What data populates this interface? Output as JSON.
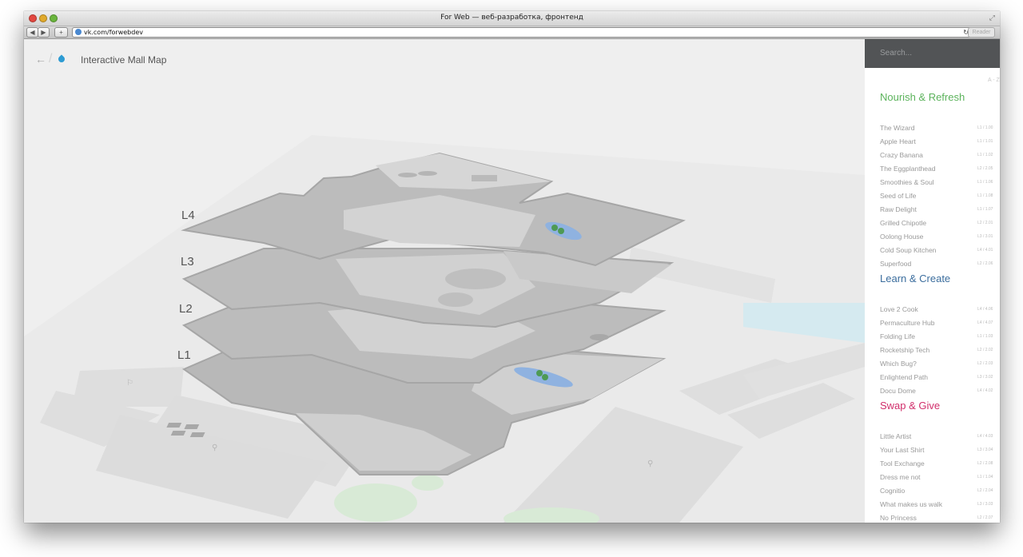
{
  "window": {
    "title": "For Web — веб-разработка, фронтенд",
    "url": "vk.com/forwebdev",
    "reader_label": "Reader"
  },
  "app": {
    "title": "Interactive Mall Map",
    "back_icon": "arrow-left-icon",
    "logo_icon": "drop-icon",
    "levels": [
      "L4",
      "L3",
      "L2",
      "L1"
    ]
  },
  "sidebar": {
    "search_placeholder": "Search...",
    "sort_icon": "A - Z",
    "sections": [
      {
        "title": "Nourish & Refresh",
        "color": "#5cb35c",
        "items": [
          {
            "name": "The Wizard",
            "code": "L1 / 1.00"
          },
          {
            "name": "Apple Heart",
            "code": "L1 / 1.01"
          },
          {
            "name": "Crazy Banana",
            "code": "L1 / 1.02"
          },
          {
            "name": "The Eggplanthead",
            "code": "L2 / 2.05"
          },
          {
            "name": "Smoothies & Soul",
            "code": "L1 / 1.06"
          },
          {
            "name": "Seed of Life",
            "code": "L1 / 1.08"
          },
          {
            "name": "Raw Delight",
            "code": "L1 / 1.07"
          },
          {
            "name": "Grilled Chipotle",
            "code": "L2 / 2.01"
          },
          {
            "name": "Oolong House",
            "code": "L3 / 3.01"
          },
          {
            "name": "Cold Soup Kitchen",
            "code": "L4 / 4.01"
          },
          {
            "name": "Superfood",
            "code": "L2 / 2.06"
          }
        ]
      },
      {
        "title": "Learn & Create",
        "color": "#3c6e9e",
        "items": [
          {
            "name": "Love 2 Cook",
            "code": "L4 / 4.06"
          },
          {
            "name": "Permaculture Hub",
            "code": "L4 / 4.07"
          },
          {
            "name": "Folding Life",
            "code": "L1 / 1.03"
          },
          {
            "name": "Rocketship Tech",
            "code": "L2 / 2.02"
          },
          {
            "name": "Which Bug?",
            "code": "L2 / 2.03"
          },
          {
            "name": "Enlightend Path",
            "code": "L3 / 3.02"
          },
          {
            "name": "Docu Dome",
            "code": "L4 / 4.02"
          }
        ]
      },
      {
        "title": "Swap & Give",
        "color": "#d12e6b",
        "items": [
          {
            "name": "Little Artist",
            "code": "L4 / 4.03"
          },
          {
            "name": "Your Last Shirt",
            "code": "L3 / 3.04"
          },
          {
            "name": "Tool Exchange",
            "code": "L2 / 2.08"
          },
          {
            "name": "Dress me not",
            "code": "L1 / 1.04"
          },
          {
            "name": "Cognitio",
            "code": "L2 / 2.04"
          },
          {
            "name": "What makes us walk",
            "code": "L3 / 3.03"
          },
          {
            "name": "No Princess",
            "code": "L2 / 2.07"
          }
        ]
      }
    ]
  }
}
